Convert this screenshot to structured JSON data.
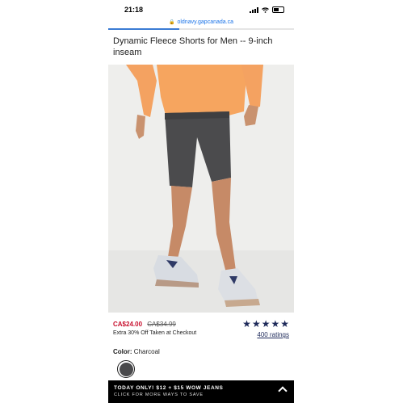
{
  "status_bar": {
    "time": "21:18"
  },
  "browser": {
    "url": "oldnavy.gapcanada.ca"
  },
  "product": {
    "title": "Dynamic Fleece Shorts for Men -- 9-inch inseam",
    "price_sale": "CA$24.00",
    "price_original": "CA$34.99",
    "promo": "Extra 30% Off Taken at Checkout",
    "rating_stars": 5,
    "ratings_count": "400 ratings",
    "color_label": "Color:",
    "color_value": "Charcoal",
    "swatch_color": "#4a4a4c"
  },
  "banner": {
    "title": "TODAY ONLY! $12 + $15 WOW JEANS",
    "subtitle": "CLICK FOR MORE WAYS TO SAVE"
  },
  "colors": {
    "sale_red": "#c8102e",
    "navy": "#1e2a5a",
    "link_blue": "#1a73e8"
  }
}
